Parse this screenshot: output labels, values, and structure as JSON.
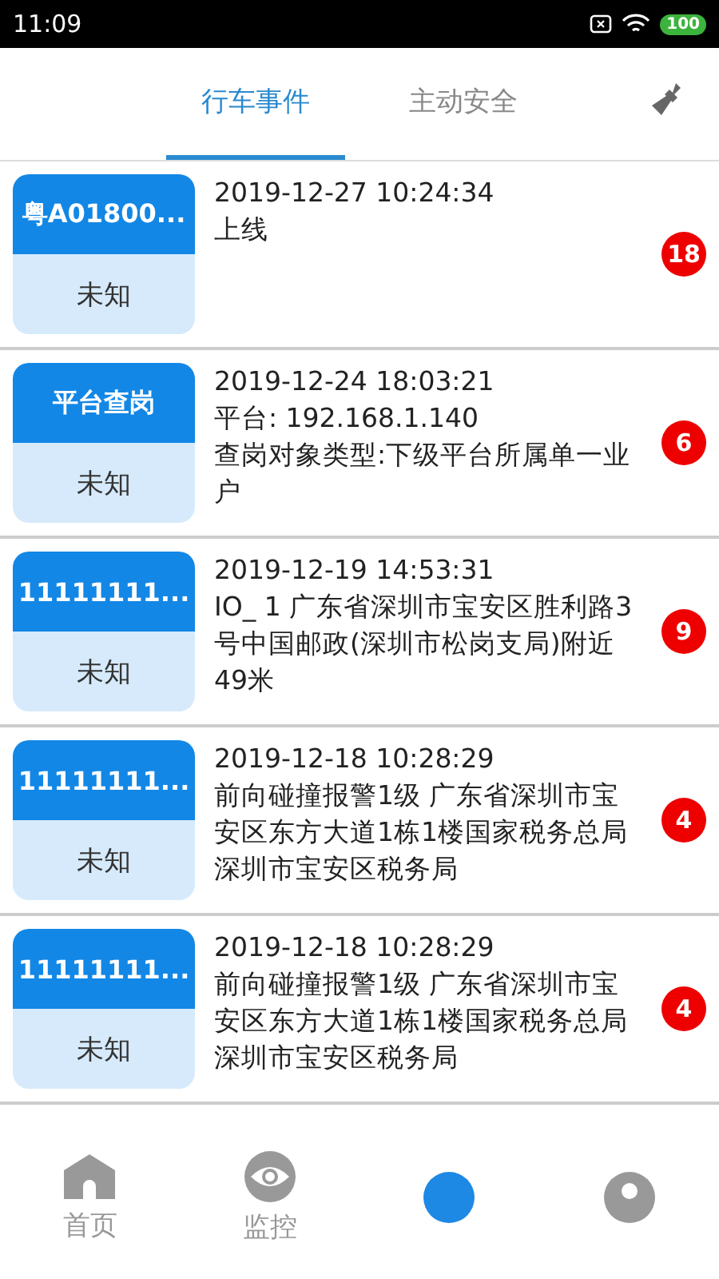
{
  "status_bar": {
    "time": "11:09",
    "battery": "100"
  },
  "tabs": [
    {
      "label": "行车事件",
      "selected": true
    },
    {
      "label": "主动安全",
      "selected": false
    }
  ],
  "events": [
    {
      "plate": "粤A01800...",
      "status": "未知",
      "time": "2019-12-27 10:24:34",
      "lines": [
        "上线"
      ],
      "count": "18"
    },
    {
      "plate": "平台查岗",
      "status": "未知",
      "time": "2019-12-24 18:03:21",
      "lines": [
        "平台: 192.168.1.140",
        "查岗对象类型:下级平台所属单一业户"
      ],
      "count": "6"
    },
    {
      "plate": "11111111...",
      "status": "未知",
      "time": "2019-12-19 14:53:31",
      "lines": [
        "IO_ 1 广东省深圳市宝安区胜利路3号中国邮政(深圳市松岗支局)附近49米"
      ],
      "count": "9"
    },
    {
      "plate": "11111111...",
      "status": "未知",
      "time": "2019-12-18 10:28:29",
      "lines": [
        "前向碰撞报警1级 广东省深圳市宝安区东方大道1栋1楼国家税务总局深圳市宝安区税务局"
      ],
      "count": "4"
    },
    {
      "plate": "11111111...",
      "status": "未知",
      "time": "2019-12-18 10:28:29",
      "lines": [
        "前向碰撞报警1级 广东省深圳市宝安区东方大道1栋1楼国家税务总局深圳市宝安区税务局"
      ],
      "count": "4"
    }
  ],
  "nav": [
    {
      "kind": "home",
      "label": "首页"
    },
    {
      "kind": "eye",
      "label": "监控"
    },
    {
      "kind": "blue"
    },
    {
      "kind": "grey"
    }
  ]
}
